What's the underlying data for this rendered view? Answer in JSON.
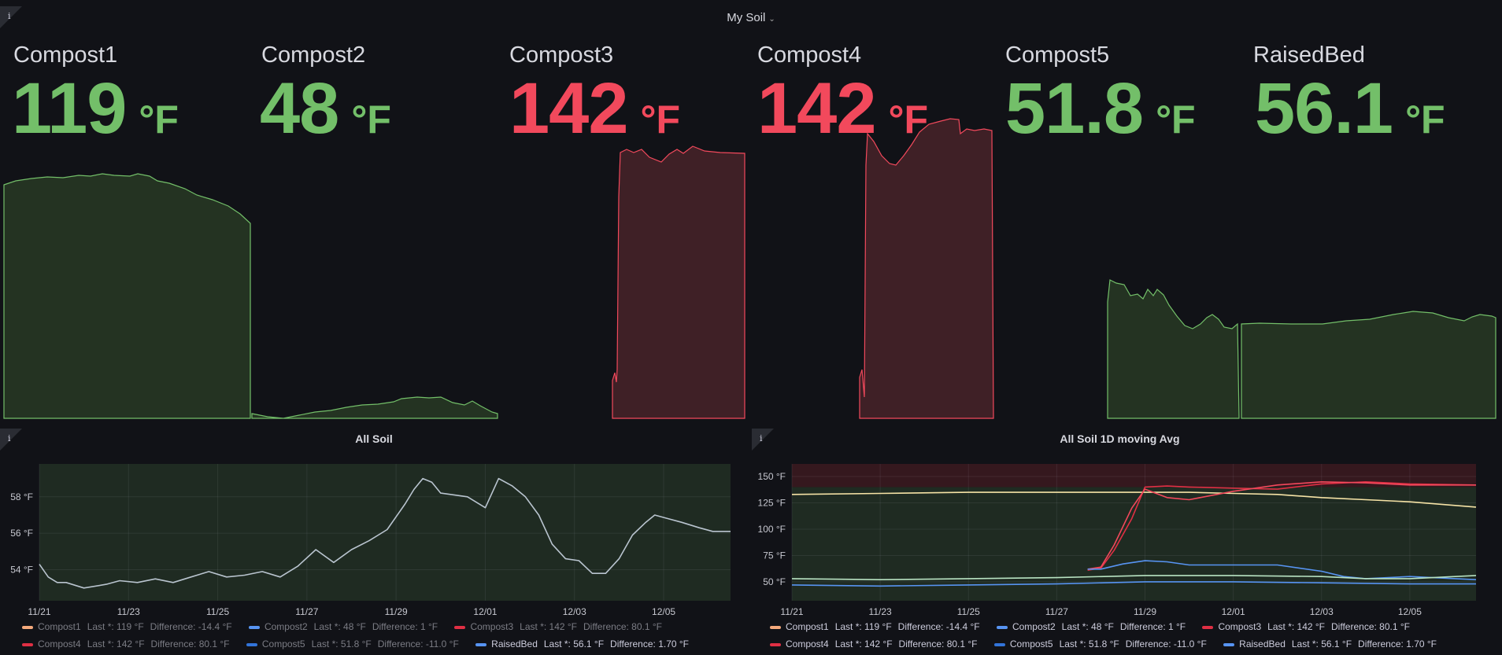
{
  "dashboard": {
    "title": "My Soil",
    "info_icon": "i"
  },
  "stats": [
    {
      "name": "Compost1",
      "value": "119",
      "unit": "°F",
      "color": "#73bf69"
    },
    {
      "name": "Compost2",
      "value": "48",
      "unit": "°F",
      "color": "#73bf69"
    },
    {
      "name": "Compost3",
      "value": "142",
      "unit": "°F",
      "color": "#f2495c"
    },
    {
      "name": "Compost4",
      "value": "142",
      "unit": "°F",
      "color": "#f2495c"
    },
    {
      "name": "Compost5",
      "value": "51.8",
      "unit": "°F",
      "color": "#73bf69"
    },
    {
      "name": "RaisedBed",
      "value": "56.1",
      "unit": "°F",
      "color": "#73bf69"
    }
  ],
  "panels": {
    "all_soil": {
      "title": "All Soil"
    },
    "all_soil_avg": {
      "title": "All Soil 1D moving Avg"
    }
  },
  "legend": [
    {
      "name": "Compost1",
      "last": "Last *: 119 °F",
      "diff": "Difference: -14.4 °F",
      "color": "#f4a97c"
    },
    {
      "name": "Compost2",
      "last": "Last *: 48 °F",
      "diff": "Difference: 1 °F",
      "color": "#5794f2"
    },
    {
      "name": "Compost3",
      "last": "Last *: 142 °F",
      "diff": "Difference: 80.1 °F",
      "color": "#e02f44"
    },
    {
      "name": "Compost4",
      "last": "Last *: 142 °F",
      "diff": "Difference: 80.1 °F",
      "color": "#e02f44"
    },
    {
      "name": "Compost5",
      "last": "Last *: 51.8 °F",
      "diff": "Difference: -11.0 °F",
      "color": "#3274d9"
    },
    {
      "name": "RaisedBed",
      "last": "Last *: 56.1 °F",
      "diff": "Difference: 1.70 °F",
      "color": "#5794f2"
    }
  ],
  "chart_data": [
    {
      "type": "line",
      "title": "All Soil",
      "x_ticks": [
        "11/21",
        "11/23",
        "11/25",
        "11/27",
        "11/29",
        "12/01",
        "12/03",
        "12/05"
      ],
      "x_range": [
        0,
        15.5
      ],
      "ylim": [
        52.3,
        59.8
      ],
      "y_ticks": [
        "54 °F",
        "56 °F",
        "58 °F"
      ],
      "y_tick_values": [
        54,
        56,
        58
      ],
      "series": [
        {
          "x": [
            0,
            0.2,
            0.4,
            0.6,
            1,
            1.5,
            1.8,
            2.2,
            2.6,
            3,
            3.4,
            3.8,
            4.2,
            4.6,
            5,
            5.4,
            5.8,
            6.2,
            6.6,
            7,
            7.4,
            7.8,
            8.2,
            8.4,
            8.6,
            8.8,
            9,
            9.3,
            9.6,
            10,
            10.3,
            10.6,
            10.9,
            11.2,
            11.5,
            11.8,
            12.1,
            12.4,
            12.7,
            13,
            13.3,
            13.6,
            13.8,
            14.1,
            14.4,
            14.8,
            15.1,
            15.5
          ],
          "values": [
            54.3,
            53.6,
            53.3,
            53.3,
            53.0,
            53.2,
            53.4,
            53.3,
            53.5,
            53.3,
            53.6,
            53.9,
            53.6,
            53.7,
            53.9,
            53.6,
            54.2,
            55.1,
            54.4,
            55.1,
            55.6,
            56.2,
            57.6,
            58.4,
            59.0,
            58.8,
            58.2,
            58.1,
            58.0,
            57.4,
            59.0,
            58.6,
            58.0,
            57.0,
            55.4,
            54.6,
            54.5,
            53.8,
            53.8,
            54.6,
            55.9,
            56.6,
            57.0,
            56.8,
            56.6,
            56.3,
            56.1,
            56.1
          ]
        }
      ]
    },
    {
      "type": "line",
      "title": "All Soil 1D moving Avg",
      "x_ticks": [
        "11/21",
        "11/23",
        "11/25",
        "11/27",
        "11/29",
        "12/01",
        "12/03",
        "12/05"
      ],
      "x_range": [
        0,
        15.5
      ],
      "ylim": [
        32,
        162
      ],
      "y_ticks": [
        "50 °F",
        "75 °F",
        "100 °F",
        "125 °F",
        "150 °F"
      ],
      "y_tick_values": [
        50,
        75,
        100,
        125,
        150
      ],
      "series": [
        {
          "name": "Compost1",
          "x": [
            0,
            2,
            4,
            6,
            8,
            9,
            10,
            11,
            12,
            13,
            14,
            15.5
          ],
          "values": [
            133,
            134,
            135,
            135,
            135,
            135,
            134,
            133,
            130,
            128,
            126,
            121
          ]
        },
        {
          "name": "Compost2",
          "x": [
            0,
            2,
            4,
            6,
            8,
            10,
            12,
            14,
            15.5
          ],
          "values": [
            47,
            46,
            47,
            48,
            50,
            50,
            49,
            48,
            48
          ]
        },
        {
          "name": "Compost3",
          "x": [
            6.7,
            7,
            7.3,
            7.7,
            8,
            8.5,
            9,
            10,
            11,
            12,
            13,
            14,
            15.5
          ],
          "values": [
            61,
            63,
            80,
            110,
            140,
            141,
            140,
            139,
            138,
            143,
            145,
            143,
            142
          ]
        },
        {
          "name": "Compost4",
          "x": [
            6.7,
            7,
            7.3,
            7.7,
            8,
            8.5,
            9,
            10,
            11,
            12,
            13,
            14,
            15.5
          ],
          "values": [
            62,
            64,
            85,
            120,
            138,
            130,
            128,
            136,
            142,
            145,
            144,
            142,
            142
          ]
        },
        {
          "name": "Compost5",
          "x": [
            6.7,
            7,
            7.5,
            8,
            8.5,
            9,
            10,
            11,
            12,
            12.5,
            13,
            14,
            15.5
          ],
          "values": [
            62,
            62,
            67,
            70,
            69,
            66,
            66,
            66,
            60,
            55,
            53,
            55,
            52
          ]
        },
        {
          "name": "RaisedBed",
          "x": [
            0,
            2,
            4,
            6,
            8,
            10,
            12,
            13,
            14,
            15.5
          ],
          "values": [
            53,
            52,
            53,
            54,
            56,
            56,
            55,
            53,
            53,
            56
          ]
        }
      ]
    }
  ]
}
